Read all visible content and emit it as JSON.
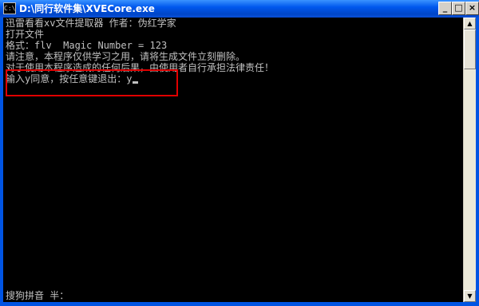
{
  "window": {
    "title": "D:\\同行软件集\\XVECore.exe",
    "sys_icon_text": "C:\\",
    "buttons": {
      "minimize": "_",
      "maximize": "□",
      "close": "×"
    },
    "colors": {
      "titlebar": "#0058ee",
      "console_bg": "#000000",
      "console_text": "#c0c0c0",
      "highlight": "#e00000"
    }
  },
  "console": {
    "lines": [
      "迅雷看看xv文件提取器 作者：伪红学家",
      "打开文件",
      "格式：flv  Magic Number = 123",
      "请注意，本程序仅供学习之用，请将生成文件立刻删除。",
      "对于使用本程序造成的任何后果，由使用者自行承担法律责任！",
      "输入y同意，按任意键退出：y"
    ],
    "ime_status": "搜狗拼音 半："
  },
  "scrollbar": {
    "up_icon": "up-arrow-icon",
    "down_icon": "down-arrow-icon"
  }
}
